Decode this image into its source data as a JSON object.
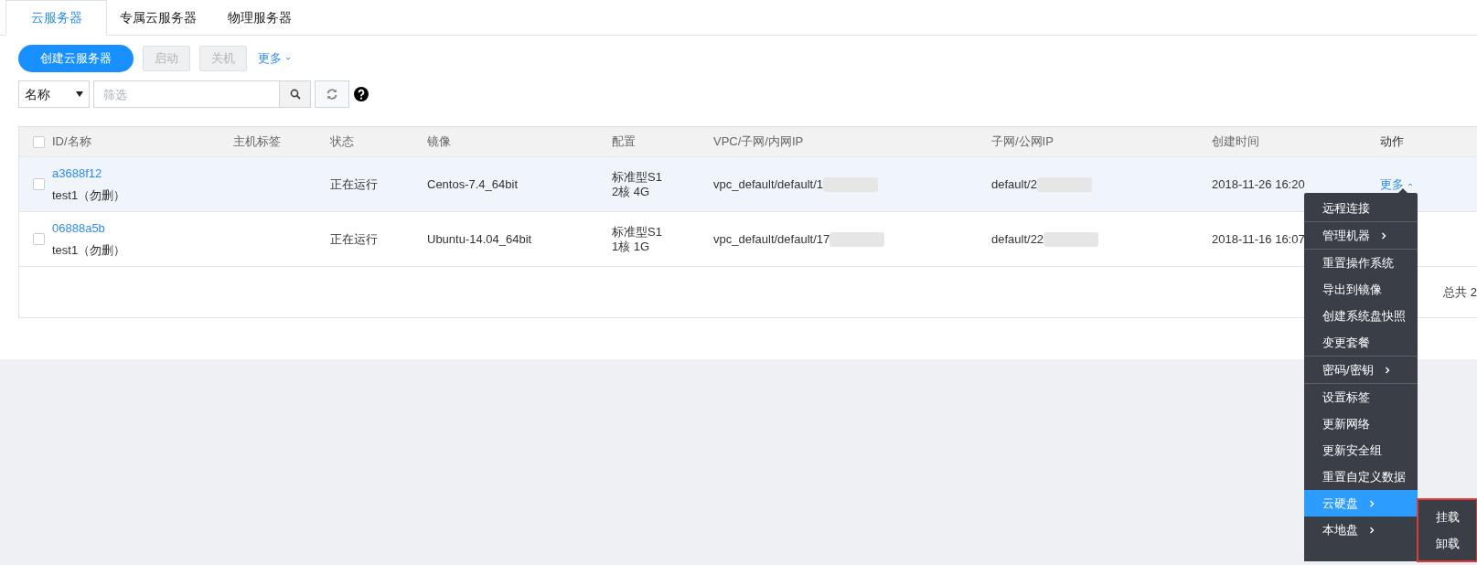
{
  "tabs": [
    {
      "label": "云服务器",
      "selected": true
    },
    {
      "label": "专属云服务器",
      "selected": false
    },
    {
      "label": "物理服务器",
      "selected": false
    }
  ],
  "toolbar": {
    "buttons": [
      {
        "label": "创建云服务器",
        "kind": "primary",
        "disabled": false
      },
      {
        "label": "启动",
        "kind": "plain",
        "disabled": true
      },
      {
        "label": "关机",
        "kind": "plain",
        "disabled": true
      }
    ],
    "more": "更多"
  },
  "filter": {
    "field": "名称",
    "placeholder": "筛选"
  },
  "table": {
    "select_all_checked": false,
    "columns": [
      "ID/名称",
      "主机标签",
      "状态",
      "镜像",
      "配置",
      "VPC/子网/内网IP",
      "子网/公网IP",
      "创建时间",
      "动作"
    ],
    "rows": [
      {
        "checked": false,
        "highlighted": true,
        "id": "a3688f12",
        "name": "test1（勿删）",
        "status": "正在运行",
        "image": "Centos-7.4_64bit",
        "spec": [
          "标准型S1",
          "2核 4G"
        ],
        "vpc": "vpc_default/default/1",
        "subnet": "default/2",
        "created": "2018-11-26 16:20",
        "action": "更多",
        "action_open": true
      },
      {
        "checked": false,
        "highlighted": false,
        "id": "06888a5b",
        "name": "test1（勿删）",
        "status": "正在运行",
        "image": "Ubuntu-14.04_64bit",
        "spec": [
          "标准型S1",
          "1核 1G"
        ],
        "vpc": "vpc_default/default/17",
        "subnet": "default/22",
        "created": "2018-11-16 16:07"
      }
    ],
    "total": "总共 2"
  },
  "menu": {
    "groups": [
      [
        {
          "label": "远程连接",
          "kind": "item",
          "selected": false
        }
      ],
      [
        {
          "label": "管理机器",
          "kind": "submenu",
          "selected": false
        }
      ],
      [
        {
          "label": "重置操作系统",
          "kind": "item",
          "selected": false
        },
        {
          "label": "导出到镜像",
          "kind": "item",
          "selected": false
        },
        {
          "label": "创建系统盘快照",
          "kind": "item",
          "selected": false
        },
        {
          "label": "变更套餐",
          "kind": "item",
          "selected": false
        }
      ],
      [
        {
          "label": "密码/密钥",
          "kind": "submenu",
          "selected": false
        }
      ],
      [
        {
          "label": "设置标签",
          "kind": "item",
          "selected": false
        },
        {
          "label": "更新网络",
          "kind": "item",
          "selected": false
        },
        {
          "label": "更新安全组",
          "kind": "item",
          "selected": false
        },
        {
          "label": "重置自定义数据",
          "kind": "item",
          "selected": false
        },
        {
          "label": "云硬盘",
          "kind": "submenu",
          "selected": true
        },
        {
          "label": "本地盘",
          "kind": "submenu",
          "selected": false
        }
      ]
    ],
    "submenu": {
      "highlighted": true,
      "items": [
        "挂载",
        "卸载"
      ]
    }
  }
}
